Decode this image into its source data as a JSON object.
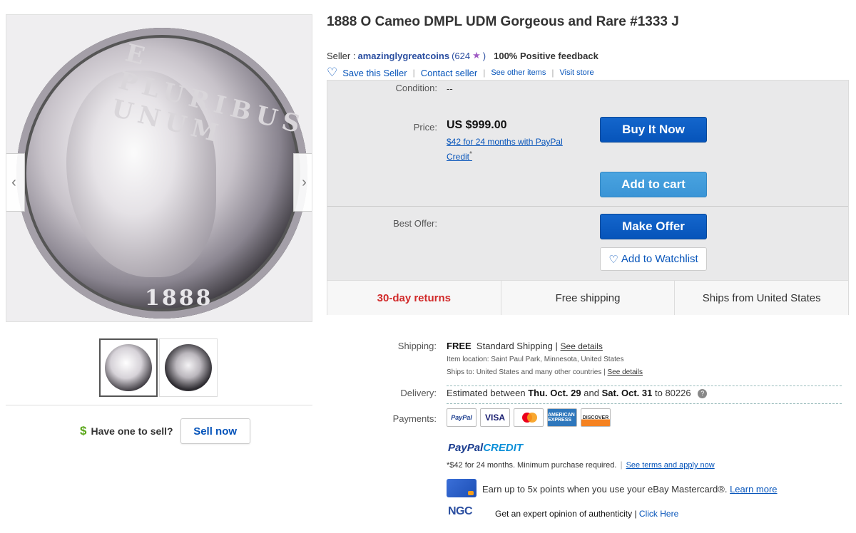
{
  "listing": {
    "title": "1888 O Cameo DMPL UDM Gorgeous and Rare #1333 J"
  },
  "seller": {
    "label": "Seller :",
    "name": "amazinglygreatcoins",
    "score_open": "(624",
    "score_close": ")",
    "feedback": "100% Positive feedback",
    "save_label": "Save this Seller",
    "contact_label": "Contact seller",
    "other_items_label": "See other items",
    "visit_store_label": "Visit store",
    "sep": "|"
  },
  "coin_image": {
    "legend": "E PLURIBUS UNUM",
    "year": "1888",
    "prev_icon": "chevron-left-icon",
    "next_icon": "chevron-right-icon"
  },
  "thumbnails": [
    {
      "name": "obverse",
      "active": true
    },
    {
      "name": "reverse",
      "active": false
    }
  ],
  "sell": {
    "question": "Have one to sell?",
    "button_label": "Sell now",
    "icon": "$"
  },
  "purchase": {
    "condition_label": "Condition:",
    "condition_value": "--",
    "price_label": "Price:",
    "price_value": "US $999.00",
    "credit_text": "$42 for 24 months with PayPal Credit",
    "credit_mark": "*",
    "buy_now_label": "Buy It Now",
    "add_to_cart_label": "Add to cart",
    "best_offer_label": "Best Offer:",
    "make_offer_label": "Make Offer",
    "watchlist_icon": "♡",
    "watchlist_label": "Add to Watchlist"
  },
  "highlights": {
    "returns": "30-day returns",
    "shipping": "Free shipping",
    "ships_from": "Ships from United States"
  },
  "details": {
    "shipping_label": "Shipping:",
    "shipping_free": "FREE",
    "shipping_method": "Standard Shipping",
    "see_details": "See details",
    "sep": "|",
    "item_location": "Item location:  Saint Paul Park, Minnesota, United States",
    "ships_to": "Ships to:  United States and many other countries",
    "delivery_label": "Delivery:",
    "delivery_prefix": "Estimated between",
    "delivery_start": "Thu. Oct. 29",
    "delivery_and": "and",
    "delivery_end": "Sat. Oct. 31",
    "delivery_suffix": "to 80226",
    "help_icon": "?",
    "payments_label": "Payments:",
    "cards": [
      "PayPal",
      "VISA",
      "MasterCard",
      "AMERICAN EXPRESS",
      "DISCOVER"
    ]
  },
  "paypal_credit": {
    "logo_a": "PayPal",
    "logo_b": "CREDIT",
    "note": "*$42 for 24 months. Minimum purchase required.",
    "sep": "|",
    "link": "See terms and apply now"
  },
  "mastercard_promo": {
    "text": "Earn up to 5x points when you use your eBay Mastercard®.",
    "link": "Learn more"
  },
  "ngc": {
    "logo": "NGC",
    "text": "Get an expert opinion of authenticity |",
    "link": "Click Here"
  },
  "colors": {
    "link": "#0654ba",
    "buy_button": "#0654ba",
    "cart_button": "#3a94d6",
    "returns_red": "#d12a2a",
    "sell_dollar": "#5ba71b"
  }
}
